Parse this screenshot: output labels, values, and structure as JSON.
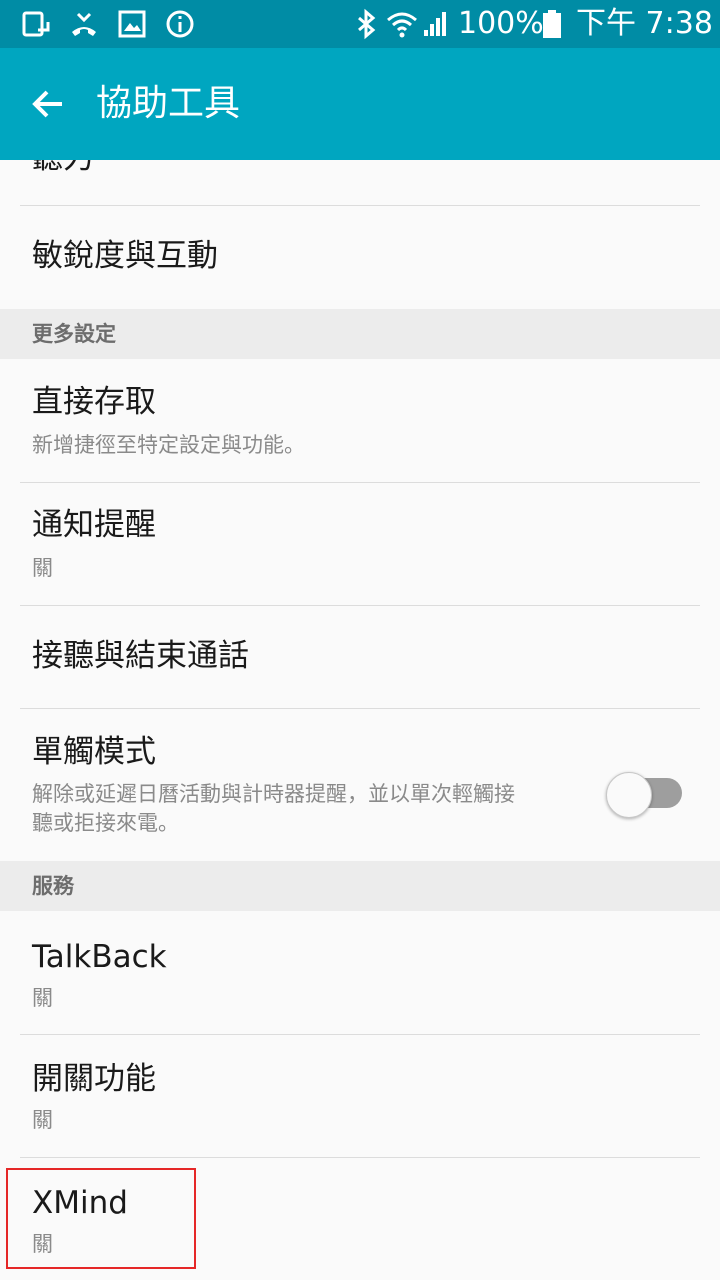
{
  "status_bar": {
    "battery": "100%",
    "time": "下午 7:38"
  },
  "app_bar": {
    "title": "協助工具"
  },
  "list": {
    "partial_item": "聽力",
    "item_interaction": "敏銳度與互動",
    "section_more": "更多設定",
    "direct_access": {
      "title": "直接存取",
      "subtitle": "新增捷徑至特定設定與功能。"
    },
    "notification_reminder": {
      "title": "通知提醒",
      "subtitle": "關"
    },
    "answer_end_calls": {
      "title": "接聽與結束通話"
    },
    "single_tap": {
      "title": "單觸模式",
      "subtitle_line1": "解除或延遲日曆活動與計時器提醒，並以單次輕觸接",
      "subtitle_line2": "聽或拒接來電。",
      "toggle_on": false
    },
    "section_services": "服務",
    "talkback": {
      "title": "TalkBack",
      "subtitle": "關"
    },
    "switch_access": {
      "title": "開關功能",
      "subtitle": "關"
    },
    "xmind": {
      "title": "XMind",
      "subtitle": "關"
    }
  },
  "colors": {
    "status_bar": "#008ca5",
    "app_bar": "#00a6c0",
    "highlight_box": "#e52727"
  }
}
